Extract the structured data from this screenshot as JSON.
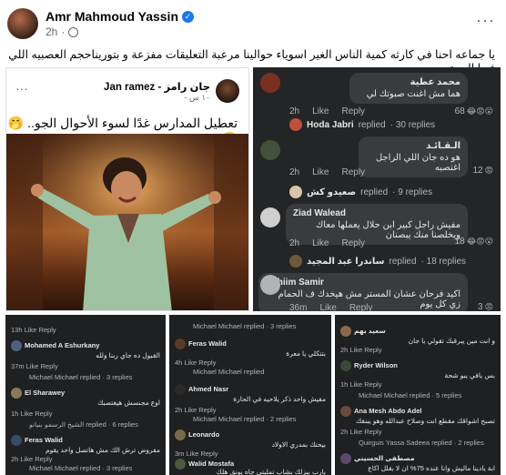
{
  "post": {
    "author": "Amr Mahmoud Yassin",
    "time": "2h",
    "caption": "يا جماعه احنا في كارثه كمية الناس الغير اسوياء حوالينا مرعبة   التعليقات مفزعة   و بتوريناحجم العصبيه اللي فيها المجتمع"
  },
  "tweet": {
    "name": "جان رامز - Jan ramez",
    "time": "١٠ س -",
    "text": "تعطيل المدارس غدًا لسوء الأحوال الجو.. 🤭🤭"
  },
  "comments": [
    {
      "name": "محمد عطية",
      "text": "هما مش اغنت صبوتك لي",
      "time": "2h",
      "like": "Like",
      "reply": "Reply",
      "reactions": "68",
      "replied_by": "Hoda Jabri",
      "replied_label": "replied",
      "replies": "· 30 replies"
    },
    {
      "name": "الـقـائـد",
      "text": "هو ده جان اللي الراجل اغتصبه",
      "time": "2h",
      "like": "Like",
      "reply": "Reply",
      "reactions": "12",
      "replied_by": "صعيدو كش",
      "replied_label": "replied",
      "replies": "· 9 replies"
    },
    {
      "name": "Ziad Walead",
      "text": "مفيش راجل كبير ابن حلال يعملها معاك ويخلصنا منك يبصنان",
      "time": "2h",
      "like": "Like",
      "reply": "Reply",
      "reactions": "18",
      "replied_by": "ساندرا عبد المجيد",
      "replied_label": "replied",
      "replies": "· 18 replies"
    },
    {
      "name": "Rahiim Samir",
      "text": "اكيد فرحان عشان المستر مش هيخدك ف الحمام زي كل يوم",
      "time": "36m",
      "like": "Like",
      "reply": "Reply",
      "reactions": "3"
    }
  ],
  "bottom": {
    "left": [
      {
        "meta": "13h  Like  Reply"
      },
      {
        "name": "Mohamed A Eshurkany",
        "text": "القبول ده جاي ربنا ولله",
        "meta": "37m  Like  Reply"
      },
      {
        "reply": "Michael Michael replied · 3 replies"
      },
      {
        "name": "El Sharawey",
        "text": "اوع مجنسش هيغتصبك",
        "meta": "1h  Like  Reply"
      },
      {
        "reply": "الشيخ الرسمو بنيانو replied · 6 replies"
      },
      {
        "name": "Feras Walid",
        "text": "مفروض ترش الك مش هاتصل واحد يقوم",
        "meta": "2h  Like  Reply"
      },
      {
        "reply": "Michael Michael replied · 3 replies"
      }
    ],
    "middle": [
      {
        "reply": "Michael Michael replied · 3 replies"
      },
      {
        "name": "Feras Walid",
        "text": "بتتكلي يا معرة",
        "meta": "4h  Like  Reply"
      },
      {
        "reply": "Michael Michael replied"
      },
      {
        "name": "Ahmed Nasr",
        "text": "مفيش واحد ذكر يلاحيه في الحارة",
        "meta": "2h  Like  Reply"
      },
      {
        "reply": "Michael Michael replied · 2 replies"
      },
      {
        "name": "Leonardo",
        "text": "بيحتك بمدري الاولاد",
        "meta": "3m  Like  Reply"
      },
      {
        "name": "Walid Mostafa",
        "text": "يارب بيزلك بشاب تمليتي جاه يونق هلك"
      }
    ],
    "right": [
      {
        "name": "سعيد بهم",
        "text": "و انت مين يبرقبك تقولي يا جان",
        "meta": "2h  Like  Reply"
      },
      {
        "name": "Ryder Wilson",
        "text": "بس يافي يبو شحة",
        "meta": "1h  Like  Reply"
      },
      {
        "reply": "Michael Michael replied · 5 replies"
      },
      {
        "name": "Ana Mesh Abdo Adel",
        "text": "تصبح اشواقك مقطع انت وصلاح عبدالله وهو يبنفك",
        "meta": "2h  Like  Reply"
      },
      {
        "reply": "Quirguis Yassa Sadeea replied · 2 replies"
      },
      {
        "name": "مصطفى الحسيني",
        "text": "ابة يادينا ماليش وانا عنده 75% ان لا بقلل اكاع"
      }
    ]
  },
  "colors": {
    "fb_blue": "#1877f2",
    "dark_bg": "#242526",
    "bubble": "#3a3b3c"
  }
}
